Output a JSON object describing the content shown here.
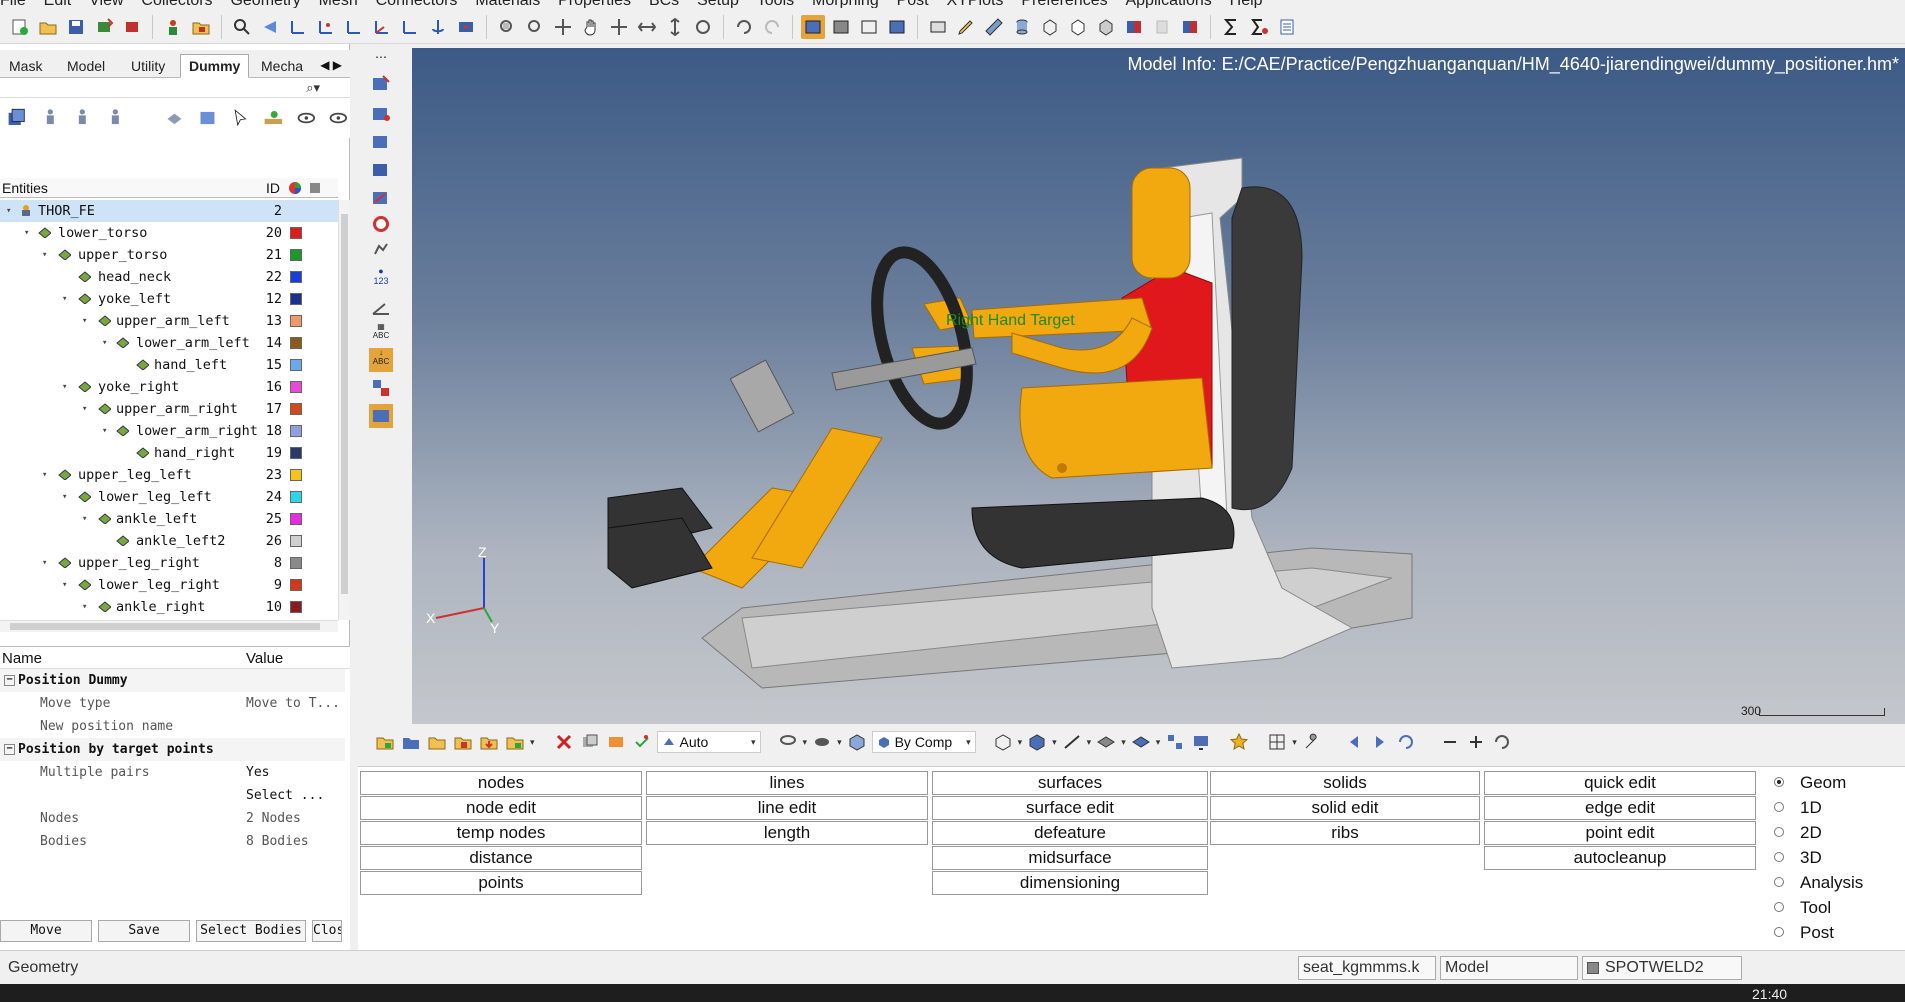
{
  "menubar": [
    "File",
    "Edit",
    "View",
    "Collectors",
    "Geometry",
    "Mesh",
    "Connectors",
    "Materials",
    "Properties",
    "BCs",
    "Setup",
    "Tools",
    "Morphing",
    "Post",
    "XYPlots",
    "Preferences",
    "Applications",
    "Help"
  ],
  "tabs": [
    "Mask",
    "Model",
    "Utility",
    "Dummy",
    "Mecha"
  ],
  "active_tab": "Dummy",
  "entities": {
    "header_label": "Entities",
    "header_id": "ID",
    "rows": [
      {
        "name": "THOR_FE",
        "id": "2",
        "color": "",
        "level": 0,
        "selected": true
      },
      {
        "name": "lower_torso",
        "id": "20",
        "color": "#e01b1b",
        "level": 1
      },
      {
        "name": "upper_torso",
        "id": "21",
        "color": "#1a9a2a",
        "level": 2
      },
      {
        "name": "head_neck",
        "id": "22",
        "color": "#1a3fd6",
        "level": 3
      },
      {
        "name": "yoke_left",
        "id": "12",
        "color": "#1a2f8f",
        "level": 3
      },
      {
        "name": "upper_arm_left",
        "id": "13",
        "color": "#f0996a",
        "level": 4
      },
      {
        "name": "lower_arm_left",
        "id": "14",
        "color": "#8a5a1c",
        "level": 5
      },
      {
        "name": "hand_left",
        "id": "15",
        "color": "#6aa8f0",
        "level": 6
      },
      {
        "name": "yoke_right",
        "id": "16",
        "color": "#e64ad8",
        "level": 3
      },
      {
        "name": "upper_arm_right",
        "id": "17",
        "color": "#d24a1c",
        "level": 4
      },
      {
        "name": "lower_arm_right",
        "id": "18",
        "color": "#8fa0e0",
        "level": 5
      },
      {
        "name": "hand_right",
        "id": "19",
        "color": "#2a3a6a",
        "level": 6
      },
      {
        "name": "upper_leg_left",
        "id": "23",
        "color": "#f2c41c",
        "level": 2
      },
      {
        "name": "lower_leg_left",
        "id": "24",
        "color": "#2ad6e8",
        "level": 3
      },
      {
        "name": "ankle_left",
        "id": "25",
        "color": "#e82ae0",
        "level": 4
      },
      {
        "name": "ankle_left2",
        "id": "26",
        "color": "#cfcfcf",
        "level": 5
      },
      {
        "name": "upper_leg_right",
        "id": "8",
        "color": "#8a8a8a",
        "level": 2
      },
      {
        "name": "lower_leg_right",
        "id": "9",
        "color": "#d2381c",
        "level": 3
      },
      {
        "name": "ankle_right",
        "id": "10",
        "color": "#8a1c1c",
        "level": 4
      }
    ]
  },
  "props": {
    "name_header": "Name",
    "value_header": "Value",
    "rows": [
      {
        "name": "Position Dummy",
        "value": "",
        "group": true
      },
      {
        "name": "Move type",
        "value": "Move to T..."
      },
      {
        "name": "New position name",
        "value": ""
      },
      {
        "name": "Position by target points",
        "value": "",
        "group": true
      },
      {
        "name": "Multiple pairs",
        "value": "Yes"
      },
      {
        "name": "",
        "value": "Select ..."
      },
      {
        "name": "Nodes",
        "value": "2 Nodes"
      },
      {
        "name": "Bodies",
        "value": "8 Bodies"
      }
    ]
  },
  "left_buttons": [
    "Move",
    "Save",
    "Select Bodies",
    "Clos"
  ],
  "viewport": {
    "model_info": "Model Info: E:/CAE/Practice/Pengzhuanganquan/HM_4640-jiarendingwei/dummy_positioner.hm*",
    "target_label": "Right Hand Target",
    "scale_value": "300",
    "axis_z": "Z",
    "axis_x": "X",
    "axis_y": "Y"
  },
  "bottom_toolbar": {
    "display_mode": "Auto",
    "color_mode": "By Comp"
  },
  "menu_panel": {
    "columns": [
      [
        "nodes",
        "node edit",
        "temp nodes",
        "distance",
        "points"
      ],
      [
        "lines",
        "line edit",
        "length"
      ],
      [
        "surfaces",
        "surface edit",
        "defeature",
        "midsurface",
        "dimensioning"
      ],
      [
        "solids",
        "solid edit",
        "ribs"
      ],
      [
        "quick edit",
        "edge edit",
        "point edit",
        "autocleanup"
      ]
    ],
    "radios": [
      "Geom",
      "1D",
      "2D",
      "3D",
      "Analysis",
      "Tool",
      "Post"
    ],
    "selected_radio": "Geom"
  },
  "status": {
    "text": "Geometry",
    "include": "seat_kgmmms.k",
    "collector": "Model",
    "component": "SPOTWELD2"
  },
  "taskbar": {
    "clock": "21:40"
  },
  "colors": {
    "dummy_body": "#f2a90f",
    "dummy_red": "#e0181c",
    "viewport_top": "#3c5a86",
    "viewport_bottom": "#c4c7cb",
    "target_green": "#1a8c1a",
    "active_toolbar": "#e4a33b"
  }
}
